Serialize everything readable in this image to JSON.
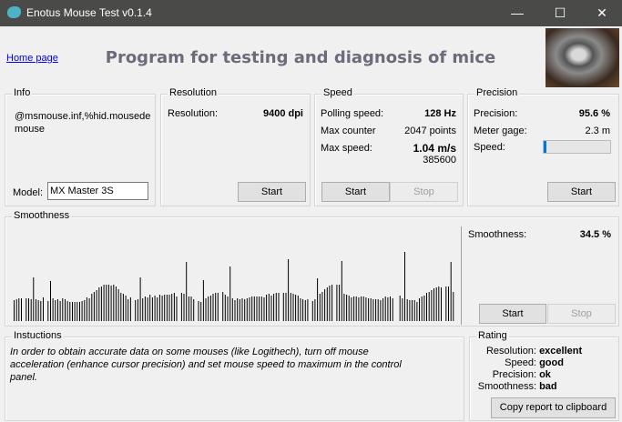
{
  "window": {
    "title": "Enotus Mouse Test v0.1.4",
    "minimize": "—",
    "maximize": "☐",
    "close": "✕"
  },
  "header": {
    "home_link": "Home page",
    "heading": "Program for testing and diagnosis of mice"
  },
  "info": {
    "label": "Info",
    "device": "@msmouse.inf,%hid.mousede mouse",
    "model_label": "Model:",
    "model_value": "MX Master 3S"
  },
  "resolution": {
    "label": "Resolution",
    "res_label": "Resolution:",
    "res_value": "9400 dpi",
    "start": "Start"
  },
  "speed": {
    "label": "Speed",
    "polling_label": "Polling speed:",
    "polling_value": "128 Hz",
    "counter_label": "Max counter",
    "counter_value": "2047 points",
    "max_label": "Max  speed:",
    "max_value": "1.04 m/s",
    "max_raw": "385600",
    "start": "Start",
    "stop": "Stop"
  },
  "precision": {
    "label": "Precision",
    "prec_label": "Precision:",
    "prec_value": "95.6 %",
    "gage_label": "Meter gage:",
    "gage_value": "2.3 m",
    "speed_label": "Speed:",
    "speed_progress_percent": 4,
    "start": "Start",
    "bar_color": "#0078d7"
  },
  "smoothness": {
    "label": "Smoothness",
    "value_label": "Smoothness:",
    "value": "34.5 %",
    "start": "Start",
    "stop": "Stop"
  },
  "chart_data": {
    "type": "bar",
    "values": [
      23,
      24,
      25,
      25,
      0,
      25,
      25,
      24,
      48,
      24,
      23,
      22,
      26,
      0,
      22,
      44,
      25,
      23,
      24,
      22,
      25,
      24,
      22,
      21,
      21,
      21,
      21,
      21,
      22,
      23,
      26,
      25,
      30,
      32,
      34,
      37,
      38,
      40,
      40,
      40,
      39,
      40,
      38,
      35,
      31,
      30,
      28,
      24,
      26,
      0,
      23,
      24,
      48,
      25,
      27,
      26,
      29,
      26,
      28,
      26,
      29,
      28,
      29,
      29,
      29,
      30,
      31,
      27,
      0,
      31,
      30,
      65,
      27,
      27,
      24,
      0,
      22,
      21,
      45,
      25,
      27,
      28,
      30,
      31,
      31,
      0,
      32,
      29,
      27,
      60,
      25,
      23,
      25,
      24,
      25,
      24,
      25,
      26,
      27,
      27,
      27,
      27,
      27,
      26,
      29,
      30,
      28,
      30,
      31,
      31,
      0,
      31,
      31,
      68,
      31,
      30,
      29,
      28,
      25,
      24,
      23,
      24,
      0,
      22,
      24,
      47,
      30,
      32,
      35,
      37,
      39,
      40,
      0,
      40,
      40,
      66,
      30,
      29,
      28,
      26,
      27,
      27,
      26,
      27,
      27,
      26,
      25,
      25,
      24,
      24,
      24,
      23,
      25,
      27,
      26,
      27,
      25,
      0,
      0,
      28,
      25,
      76,
      24,
      23,
      23,
      23,
      21,
      25,
      27,
      28,
      31,
      32,
      34,
      36,
      37,
      38,
      37,
      0,
      38,
      38,
      65,
      32
    ]
  },
  "instructions": {
    "label": "Instuctions",
    "text": "In order to obtain accurate data on some mouses (like Logithech), turn off mouse acceleration (enhance cursor precision) and set mouse speed to maximum in the control panel."
  },
  "rating": {
    "label": "Rating",
    "rows": [
      {
        "k": "Resolution:",
        "v": "excellent"
      },
      {
        "k": "Speed:",
        "v": "good"
      },
      {
        "k": "Precision:",
        "v": "ok"
      },
      {
        "k": "Smoothness:",
        "v": "bad"
      }
    ],
    "copy": "Copy report to clipboard"
  }
}
